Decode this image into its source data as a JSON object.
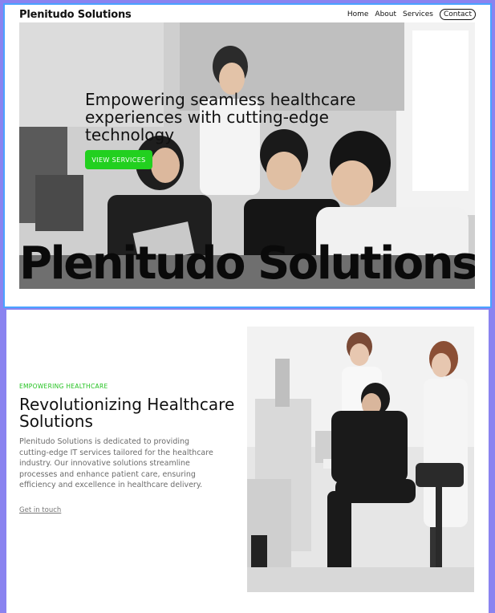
{
  "nav": {
    "brand": "Plenitudo Solutions",
    "links": [
      {
        "label": "Home"
      },
      {
        "label": "About"
      },
      {
        "label": "Services"
      },
      {
        "label": "Contact"
      }
    ]
  },
  "hero": {
    "headline": "Empowering seamless healthcare experiences with cutting-edge technology",
    "cta_label": "VIEW SERVICES",
    "big_brand": "Plenitudo Solutions"
  },
  "about": {
    "eyebrow": "EMPOWERING HEALTHCARE",
    "title": "Revolutionizing Healthcare Solutions",
    "body": "Plenitudo Solutions is dedicated to providing cutting-edge IT services  tailored for the healthcare industry. Our innovative solutions streamline processes and enhance patient care, ensuring efficiency and  excellence in healthcare delivery.",
    "link_label": "Get in touch"
  },
  "colors": {
    "accent_green": "#22d01f",
    "page_bg": "#8a83f0",
    "frame_border": "#4aa3ff"
  }
}
